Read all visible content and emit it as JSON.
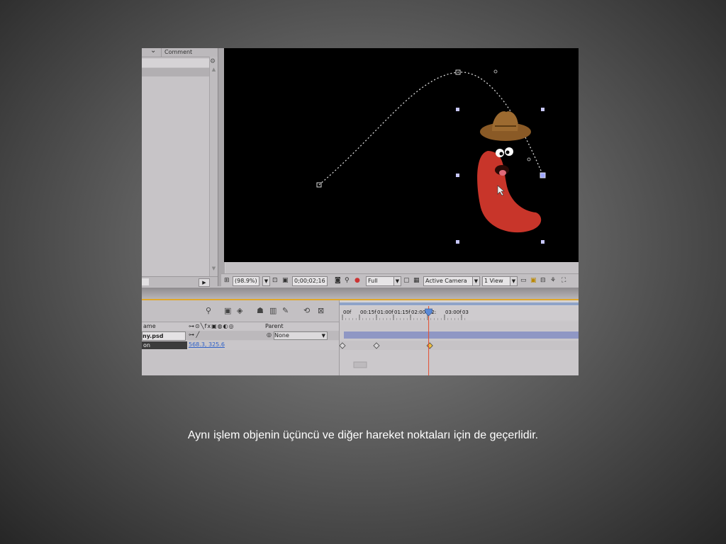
{
  "caption": "Aynı işlem objenin üçüncü ve diğer hareket noktaları için de geçerlidir.",
  "project_panel": {
    "column_label": "Comment",
    "icons": {
      "sort": "chevron-down-icon",
      "panel": "panel-icon",
      "play": "play-icon"
    }
  },
  "viewer_bar": {
    "zoom": "(98.9%)",
    "timecode": "0;00;02;16",
    "resolution": "Full",
    "camera": "Active Camera",
    "views": "1 View"
  },
  "timeline": {
    "col_name": "ame",
    "col_parent": "Parent",
    "layer_name": "ny.psd",
    "parent_value": "None",
    "property_name": "on",
    "position_x": "568.3",
    "position_separator": ", ",
    "position_y": "325.6",
    "ruler_ticks": [
      "00f",
      "00:15f",
      "01:00f",
      "01:15f",
      "02:00f",
      "02:",
      "03:00f",
      "03"
    ],
    "keyframes_frames": [
      0,
      30,
      77
    ],
    "current_frame": 76,
    "colors": {
      "playhead": "#e44b2e",
      "work_area": "#8f97c4",
      "keyframe_active": "#f0c040"
    }
  }
}
